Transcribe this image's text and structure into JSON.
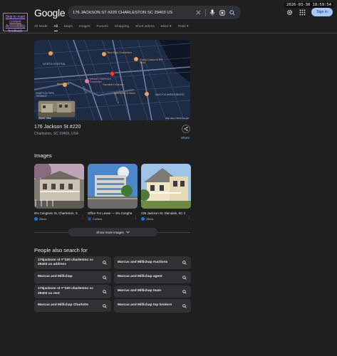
{
  "accessibility": {
    "line1": "Skip to main",
    "line2": "content",
    "line3": "Accessibility",
    "line4": "feedback"
  },
  "datetime": "2026-03-30 18:59:54",
  "header": {
    "logo": "Google",
    "query": "176 JACKSON ST #220 CHARLESTON SC 29403 US",
    "signin": "Sign in"
  },
  "tabs": [
    "All Mode",
    "All",
    "Maps",
    "Images",
    "Forums",
    "Shopping",
    "Short videos",
    "More ▾",
    "Tools ▾"
  ],
  "map": {
    "labels": {
      "north_central": "NORTH CENTRAL",
      "taco_boy": "Taco Boy Charleston",
      "grand_casino": "Grand Casino & Rib Shop",
      "berkeleys": "Berkeley's",
      "mixson": "Mixson Charleston Downtown",
      "hannibals": "Hannibal's Kitchen",
      "mercantile": "Mercantile & Mash",
      "mazyck": "MAZYCK-WRAGGBORO",
      "hampton": "HAMPTON PARK TERRACE",
      "king_st": "King St",
      "meeting_st": "Meeting St",
      "street_view": "Street View",
      "footer": "Map data ©2026 Google"
    }
  },
  "place": {
    "name": "176 Jackson St #220",
    "address": "Charleston, SC 29403, USA",
    "share_label": "Share"
  },
  "images": {
    "title": "Images",
    "items": [
      {
        "caption": "5% Congress St, Charleston, S",
        "source": "Zillow",
        "source_color": "#1a73e8"
      },
      {
        "caption": "Office For Lease — 5% Congha",
        "source": "Colliers",
        "source_color": "#1d4e9e"
      },
      {
        "caption": "226 Jackson St, Glendale, SC 2",
        "source": "Zillow",
        "source_color": "#1a73e8"
      }
    ],
    "show_more": "Show more images"
  },
  "people_also_search": {
    "title": "People also search for",
    "items": [
      "176jackson st #''220 charleston sc 29403 us address",
      "Marcus and Millichap Auctions",
      "Marcus and Millichap",
      "Marcus and Millichap agent",
      "176jackson st #''220 charleston sc 29403 us rent",
      "Marcus and Millichap team",
      "Marcus and Millichap Charlotte",
      "Marcus and Millichap top brokers"
    ]
  },
  "colors": {
    "background": "#1f1f1f",
    "accent": "#8ab4f8",
    "chip": "#303134",
    "pin": "#ea4335"
  }
}
